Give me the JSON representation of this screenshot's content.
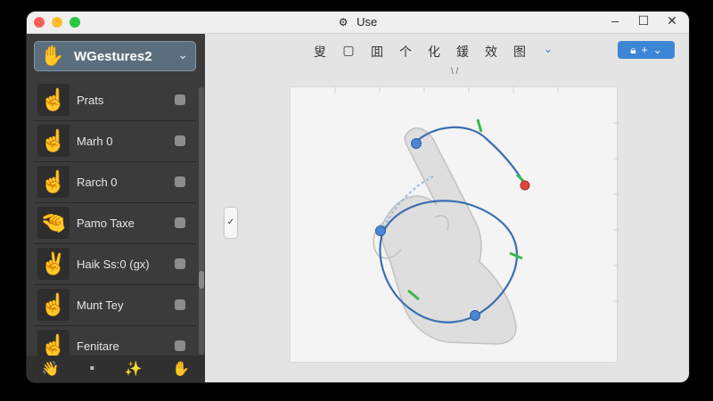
{
  "window": {
    "title": "Use",
    "title_icon": "app-gear-icon",
    "controls": [
      "–",
      "☐",
      "✕"
    ]
  },
  "sidebar": {
    "header_title": "WGestures2",
    "header_icon": "hand-gesture-icon",
    "items": [
      {
        "label": "Prats",
        "icon": "pointing-hand-icon"
      },
      {
        "label": "Marh 0",
        "icon": "pointing-hand-icon"
      },
      {
        "label": "Rarch 0",
        "icon": "pointing-hand-icon"
      },
      {
        "label": "Pamo Taxe",
        "icon": "pinch-hand-icon"
      },
      {
        "label": "Haik Ss:0 (gx)",
        "icon": "peace-hand-icon"
      },
      {
        "label": "Munt Tey",
        "icon": "pointing-hand-icon"
      },
      {
        "label": "Fenitare",
        "icon": "pointing-hand-icon"
      }
    ],
    "footer_icons": [
      "hand-wave-icon",
      "square-icon",
      "sparkle-hand-icon",
      "open-hand-icon"
    ]
  },
  "toolbar": {
    "tools": [
      "叟",
      "▢",
      "囬",
      "个",
      "化",
      "鍰",
      "效",
      "图"
    ],
    "chevron": "⌄",
    "cursor": "\\ /",
    "action_label": "+"
  },
  "side_toggle": "✓",
  "colors": {
    "sidebar_bg": "#3b3b3b",
    "accent": "#3d86d6",
    "path_stroke": "#3a6fb0",
    "point_blue": "#4a86d4",
    "tick_green": "#3cb84a",
    "point_red": "#e0453c"
  }
}
